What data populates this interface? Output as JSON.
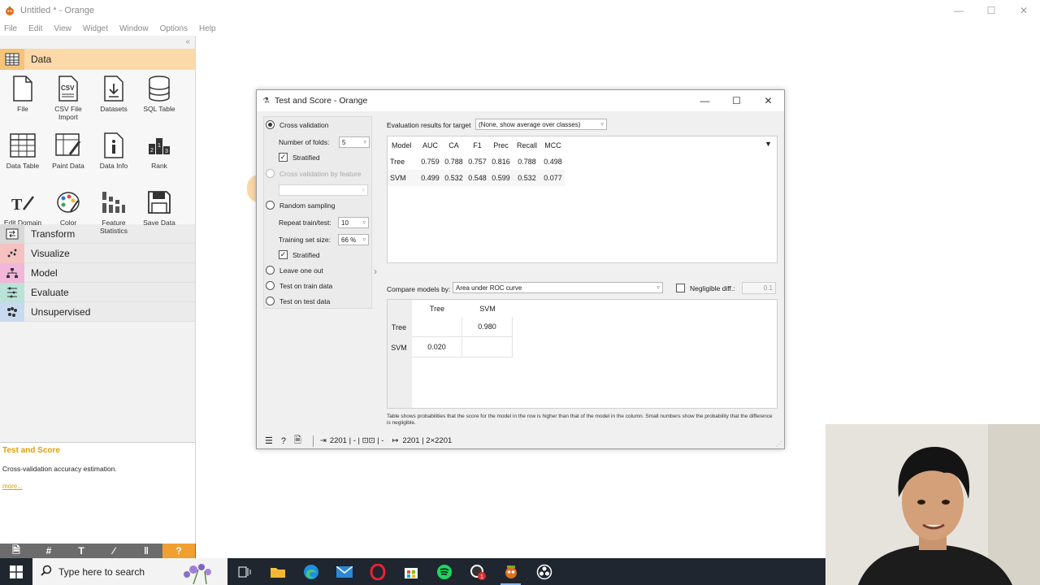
{
  "window": {
    "title": "Untitled * - Orange"
  },
  "menu": [
    "File",
    "Edit",
    "View",
    "Widget",
    "Window",
    "Options",
    "Help"
  ],
  "categories": {
    "data": "Data",
    "transform": "Transform",
    "visualize": "Visualize",
    "model": "Model",
    "evaluate": "Evaluate",
    "unsupervised": "Unsupervised"
  },
  "widgets": [
    {
      "label": "File",
      "icon": "file-icon"
    },
    {
      "label": "CSV File Import",
      "icon": "csv-icon"
    },
    {
      "label": "Datasets",
      "icon": "datasets-icon"
    },
    {
      "label": "SQL Table",
      "icon": "database-icon"
    },
    {
      "label": "Data Table",
      "icon": "table-icon"
    },
    {
      "label": "Paint Data",
      "icon": "paint-icon"
    },
    {
      "label": "Data Info",
      "icon": "info-icon"
    },
    {
      "label": "Rank",
      "icon": "rank-icon"
    },
    {
      "label": "Edit Domain",
      "icon": "edit-domain-icon"
    },
    {
      "label": "Color",
      "icon": "palette-icon"
    },
    {
      "label": "Feature Statistics",
      "icon": "stats-icon"
    },
    {
      "label": "Save Data",
      "icon": "save-icon"
    }
  ],
  "help": {
    "title": "Test and Score",
    "text": "Cross-validation accuracy estimation.",
    "more": "more..."
  },
  "dialog": {
    "title": "Test and Score - Orange",
    "sampling": {
      "cross_validation": "Cross validation",
      "folds_label": "Number of folds:",
      "folds_value": "5",
      "stratified": "Stratified",
      "cv_by_feature": "Cross validation by feature",
      "random_sampling": "Random sampling",
      "repeat_label": "Repeat train/test:",
      "repeat_value": "10",
      "train_size_label": "Training set size:",
      "train_size_value": "66 %",
      "stratified2": "Stratified",
      "leave_one_out": "Leave one out",
      "test_on_train": "Test on train data",
      "test_on_test": "Test on test data"
    },
    "eval_label": "Evaluation results for target",
    "eval_target": "(None, show average over classes)",
    "scores": {
      "headers": [
        "Model",
        "AUC",
        "CA",
        "F1",
        "Prec",
        "Recall",
        "MCC"
      ],
      "rows": [
        [
          "Tree",
          "0.759",
          "0.788",
          "0.757",
          "0.816",
          "0.788",
          "0.498"
        ],
        [
          "SVM",
          "0.499",
          "0.532",
          "0.548",
          "0.599",
          "0.532",
          "0.077"
        ]
      ]
    },
    "compare_label": "Compare models by:",
    "compare_value": "Area under ROC curve",
    "negligible_label": "Negligible diff.:",
    "negligible_value": "0.1",
    "compare": {
      "col_headers": [
        "Tree",
        "SVM"
      ],
      "row_headers": [
        "Tree",
        "SVM"
      ],
      "tree_svm": "0.980",
      "svm_tree": "0.020"
    },
    "footnote": "Table shows probabilities that the score for the model in the row is higher than that of the model in the column. Small numbers show the probability that the difference is negligible.",
    "status": {
      "input": "2201 | - | ⊡⊡ | -",
      "output": "2201 | 2×2201"
    }
  },
  "taskbar": {
    "search_placeholder": "Type here to search"
  },
  "colors": {
    "data_category": "#fcd9a8",
    "help_accent": "#e0a000",
    "taskbar": "#1f2630"
  }
}
